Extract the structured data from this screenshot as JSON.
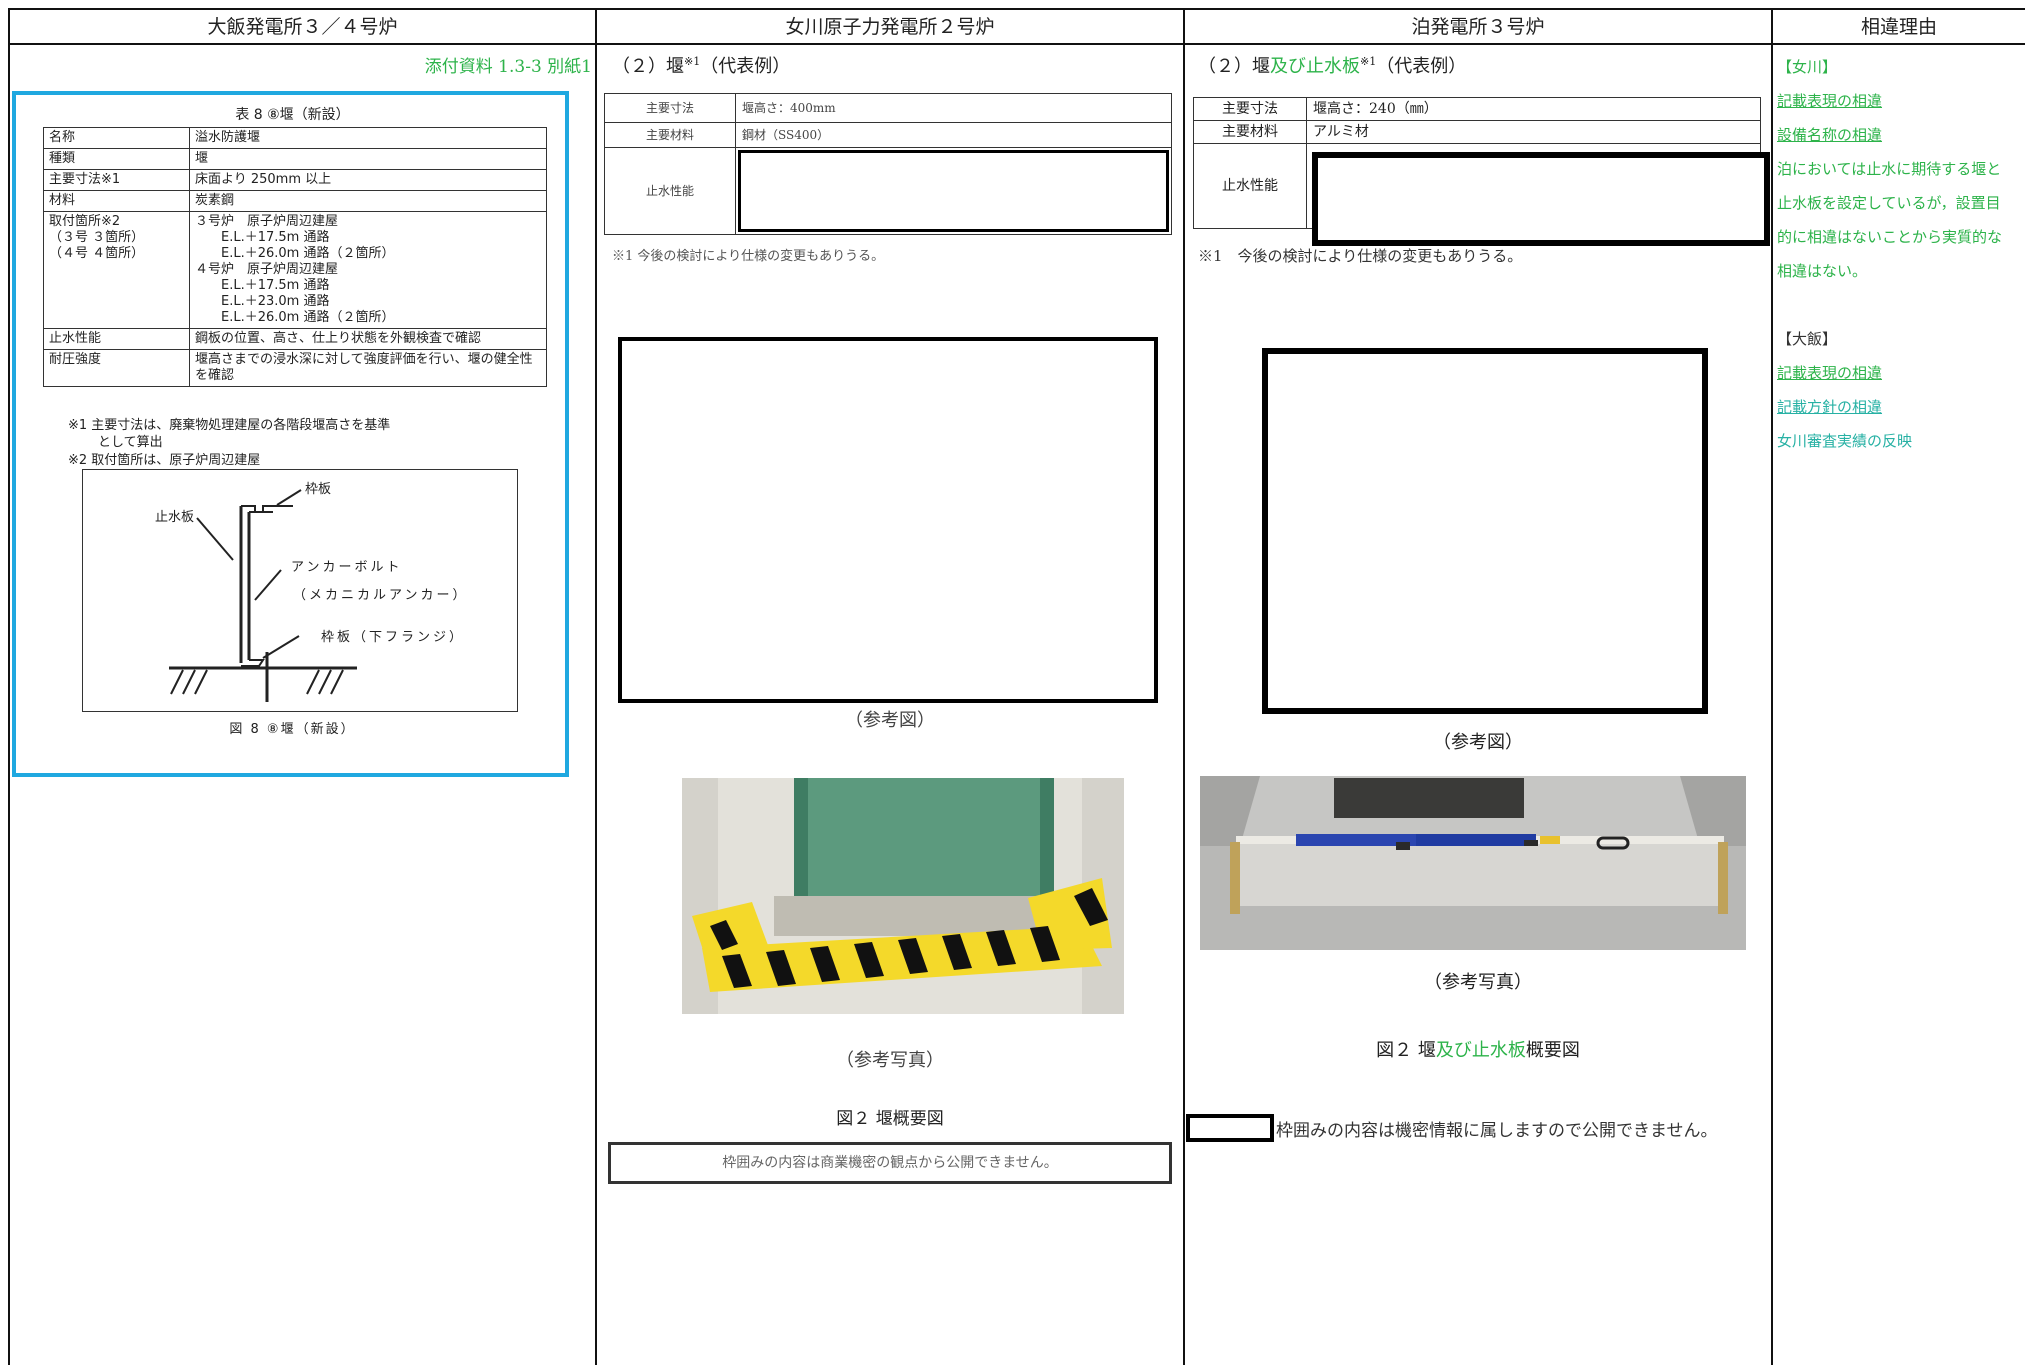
{
  "headers": {
    "col1": "大飯発電所３／４号炉",
    "col2": "女川原子力発電所２号炉",
    "col3": "泊発電所３号炉",
    "col4": "相違理由"
  },
  "col1": {
    "attachment_ref": "添付資料 1.3-3 別紙1",
    "table_caption": "表 8 ⑧堰（新設）",
    "rows": [
      {
        "label": "名称",
        "value": "溢水防護堰"
      },
      {
        "label": "種類",
        "value": "堰"
      },
      {
        "label": "主要寸法※1",
        "value": "床面より 250mm 以上"
      },
      {
        "label": "材料",
        "value": "炭素鋼"
      },
      {
        "label": "取付箇所※2\n（３号 ３箇所）\n（４号 ４箇所）",
        "value": "３号炉　原子炉周辺建屋\n　　E.L.＋17.5m 通路\n　　E.L.＋26.0m 通路（２箇所）\n４号炉　原子炉周辺建屋\n　　E.L.＋17.5m 通路\n　　E.L.＋23.0m 通路\n　　E.L.＋26.0m 通路（２箇所）"
      },
      {
        "label": "止水性能",
        "value": "鋼板の位置、高さ、仕上り状態を外観検査で確認"
      },
      {
        "label": "耐圧強度",
        "value": "堰高さまでの浸水深に対して強度評価を行い、堰の健全性を確認"
      }
    ],
    "note1": "※1 主要寸法は、廃棄物処理建屋の各階段堰高さを基準",
    "note1b": "として算出",
    "note2": "※2 取付箇所は、原子炉周辺建屋",
    "diagram": {
      "label_waku": "枠板",
      "label_shisui": "止水板",
      "label_anchor": "アンカーボルト",
      "label_anchor2": "（メカニカルアンカー）",
      "label_flange": "枠板（下フランジ）"
    },
    "figure_caption": "図 8 ⑧堰（新設）"
  },
  "col2": {
    "section_title": "（２）堰",
    "section_sup": "※1",
    "section_suffix": "（代表例）",
    "rows": [
      {
        "label": "主要寸法",
        "value": "堰高さ：400mm"
      },
      {
        "label": "主要材料",
        "value": "鋼材（SS400）"
      },
      {
        "label": "止水性能",
        "value": ""
      }
    ],
    "note": "※1 今後の検討により仕様の変更もありうる。",
    "ref_fig": "（参考図）",
    "ref_photo": "（参考写真）",
    "figure_caption": "図２ 堰概要図",
    "confidential": "枠囲みの内容は商業機密の観点から公開できません。"
  },
  "col3": {
    "section_title_a": "（２）堰",
    "section_title_b": "及び止水板",
    "section_sup": "※1",
    "section_suffix": "（代表例）",
    "rows": [
      {
        "label": "主要寸法",
        "value": "堰高さ：240（㎜）"
      },
      {
        "label": "主要材料",
        "value": "アルミ材"
      },
      {
        "label": "止水性能",
        "value": ""
      }
    ],
    "note": "※1　今後の検討により仕様の変更もありうる。",
    "ref_fig": "（参考図）",
    "ref_photo": "（参考写真）",
    "figure_caption_a": "図２ 堰",
    "figure_caption_b": "及び止水板",
    "figure_caption_c": "概要図",
    "confidential": "枠囲みの内容は機密情報に属しますので公開できません。"
  },
  "col4": {
    "onagawa_tag": "【女川】",
    "onagawa_items": [
      "記載表現の相違",
      "設備名称の相違"
    ],
    "onagawa_text": [
      "泊においては止水に期待する堰と",
      "止水板を設定しているが，設置目",
      "的に相違はないことから実質的な",
      "相違はない。"
    ],
    "ohi_tag": "【大飯】",
    "ohi_items": [
      "記載表現の相違",
      "記載方針の相違"
    ],
    "ohi_text": "女川審査実績の反映"
  },
  "colors": {
    "highlight_box": "#1fa8e0",
    "green_text": "#2db34a",
    "teal_text": "#27b1a4"
  }
}
